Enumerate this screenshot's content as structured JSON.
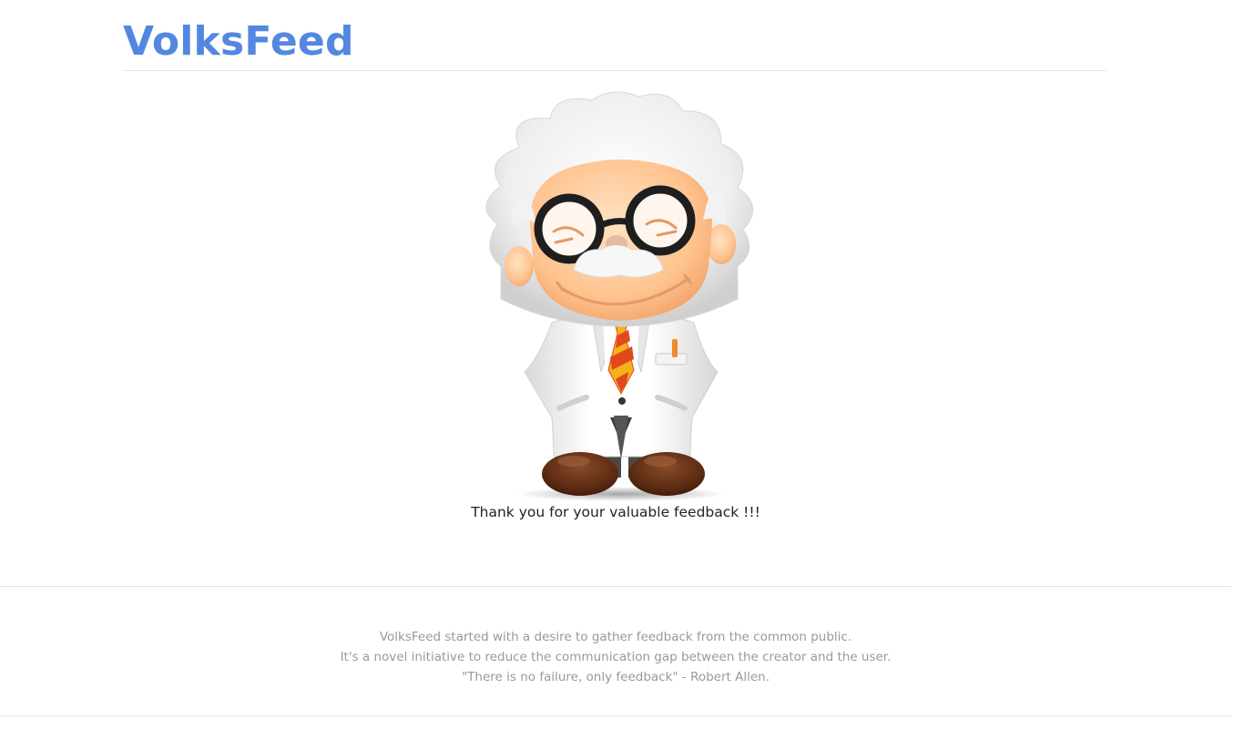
{
  "header": {
    "brand": "VolksFeed"
  },
  "mascot": {
    "icon": "scientist-mascot-icon"
  },
  "main": {
    "thanks_message": "Thank you for your valuable feedback !!!"
  },
  "footer": {
    "line1": "VolksFeed started with a desire to gather feedback from the common public.",
    "line2": "It's a novel initiative to reduce the communication gap between the creator and the user.",
    "line3": "\"There is no failure, only feedback\" - Robert Allen."
  },
  "colors": {
    "brand": "#5387e0",
    "footer_text": "#999999"
  }
}
